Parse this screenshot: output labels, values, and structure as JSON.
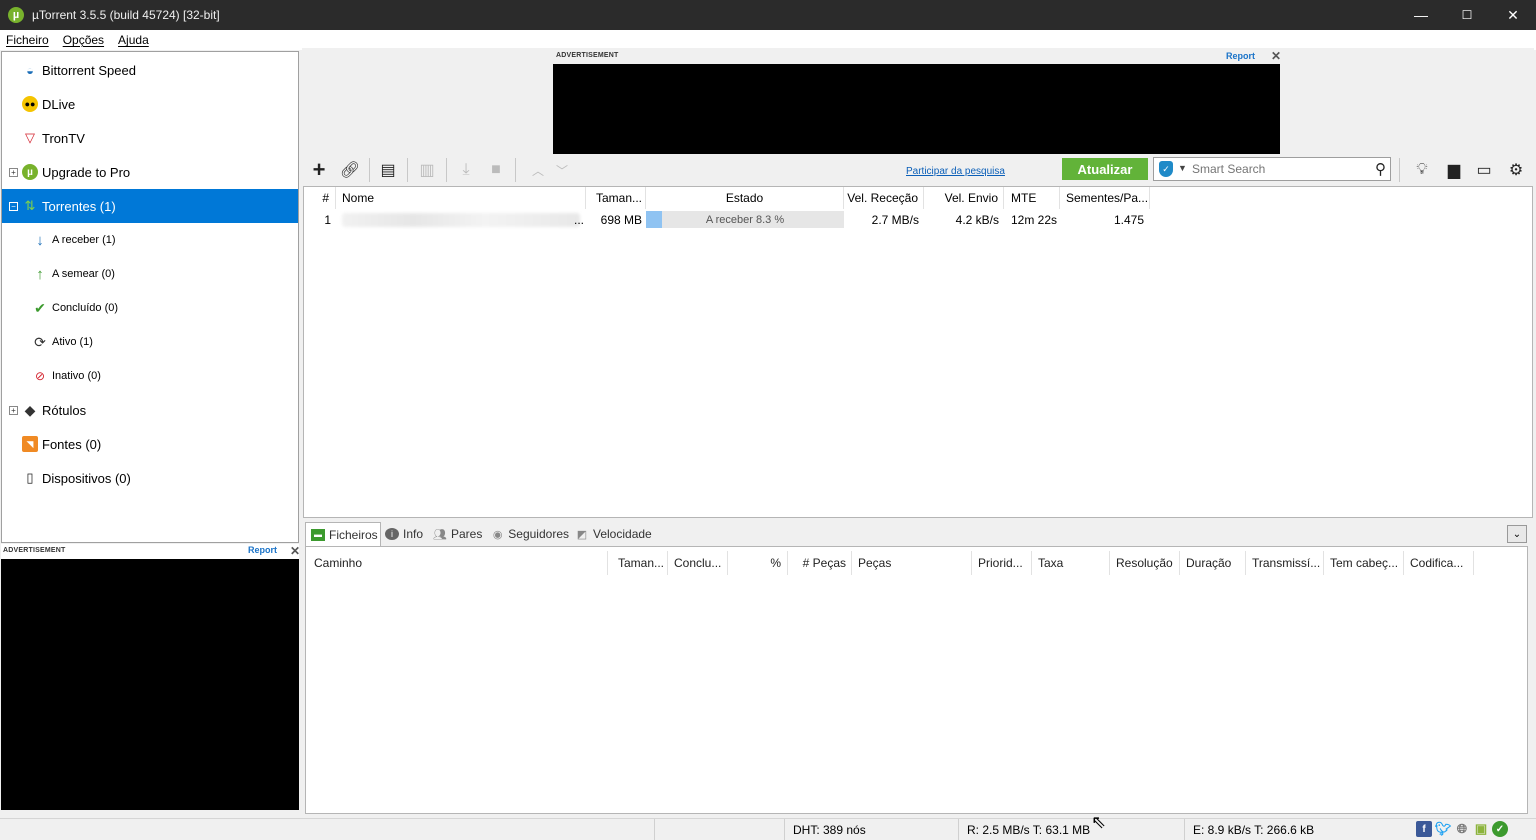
{
  "window": {
    "title": "µTorrent 3.5.5  (build 45724) [32-bit]",
    "logo": "µ",
    "minimize": "—",
    "maximize": "☐",
    "close": "✕"
  },
  "menu": {
    "items": [
      "Ficheiro",
      "Opções",
      "Ajuda"
    ]
  },
  "sidebar": {
    "items": [
      {
        "label": "Bittorrent Speed",
        "icon": "speed-gauge-icon"
      },
      {
        "label": "DLive",
        "icon": "dlive-icon"
      },
      {
        "label": "TronTV",
        "icon": "trontv-icon"
      },
      {
        "label": "Upgrade to Pro",
        "icon": "utorrent-pro-icon"
      },
      {
        "label": "Torrentes (1)",
        "icon": "torrents-icon",
        "selected": true
      },
      {
        "label": "A receber (1)",
        "icon": "download-arrow-icon"
      },
      {
        "label": "A semear (0)",
        "icon": "upload-arrow-icon"
      },
      {
        "label": "Concluído (0)",
        "icon": "checkmark-icon"
      },
      {
        "label": "Ativo (1)",
        "icon": "refresh-icon"
      },
      {
        "label": "Inativo (0)",
        "icon": "inactive-icon"
      },
      {
        "label": "Rótulos",
        "icon": "tag-icon"
      },
      {
        "label": "Fontes (0)",
        "icon": "rss-icon"
      },
      {
        "label": "Dispositivos (0)",
        "icon": "device-icon"
      }
    ]
  },
  "ads": {
    "label": "ADVERTISEMENT",
    "report": "Report",
    "close": "✕"
  },
  "toolbar": {
    "survey_link": "Participar da pesquisa",
    "update_label": "Atualizar",
    "search_placeholder": "Smart Search"
  },
  "torrent_list": {
    "columns": [
      "#",
      "Nome",
      "Taman...",
      "Estado",
      "Vel. Receção",
      "Vel. Envio",
      "MTE",
      "Sementes/Pa..."
    ],
    "rows": [
      {
        "index": "1",
        "name_suffix": "...",
        "size": "698 MB",
        "status": "A receber 8.3 %",
        "progress_percent": 8.3,
        "down_speed": "2.7 MB/s",
        "up_speed": "4.2 kB/s",
        "eta": "12m 22s",
        "seeds_peers": "1.475"
      }
    ]
  },
  "detail_tabs": [
    {
      "label": "Ficheiros",
      "icon": "files-icon",
      "active": true
    },
    {
      "label": "Info",
      "icon": "info-icon"
    },
    {
      "label": "Pares",
      "icon": "peers-icon"
    },
    {
      "label": "Seguidores",
      "icon": "trackers-icon"
    },
    {
      "label": "Velocidade",
      "icon": "speed-graph-icon"
    }
  ],
  "files_table": {
    "columns": [
      "Caminho",
      "Taman...",
      "Conclu...",
      "%",
      "# Peças",
      "Peças",
      "Priorid...",
      "Taxa",
      "Resolução",
      "Duração",
      "Transmissí...",
      "Tem cabeç...",
      "Codifica..."
    ]
  },
  "status_bar": {
    "dht": "DHT: 389 nós",
    "receive": "R: 2.5 MB/s T: 63.1 MB",
    "send": "E: 8.9 kB/s T: 266.6 kB"
  },
  "colors": {
    "selection": "#0078d7",
    "update_button": "#62b339",
    "progress_fill": "#8fc3f2",
    "link": "#0b5fb8"
  }
}
